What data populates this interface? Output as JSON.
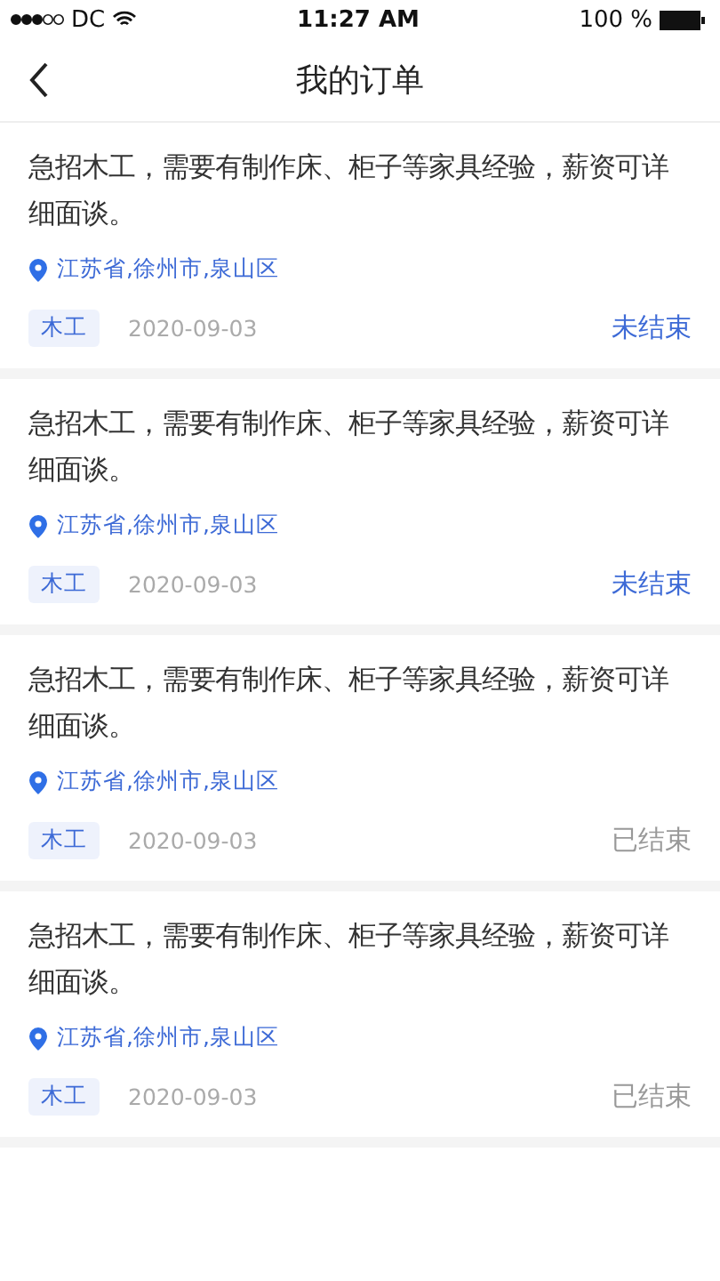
{
  "status_bar": {
    "carrier": "DC",
    "time": "11:27 AM",
    "battery": "100 %"
  },
  "header": {
    "title": "我的订单"
  },
  "orders": [
    {
      "description": "急招木工，需要有制作床、柜子等家具经验，薪资可详细面谈。",
      "location": "江苏省,徐州市,泉山区",
      "tag": "木工",
      "date": "2020-09-03",
      "status": "未结束",
      "finished": false
    },
    {
      "description": "急招木工，需要有制作床、柜子等家具经验，薪资可详细面谈。",
      "location": "江苏省,徐州市,泉山区",
      "tag": "木工",
      "date": "2020-09-03",
      "status": "未结束",
      "finished": false
    },
    {
      "description": "急招木工，需要有制作床、柜子等家具经验，薪资可详细面谈。",
      "location": "江苏省,徐州市,泉山区",
      "tag": "木工",
      "date": "2020-09-03",
      "status": "已结束",
      "finished": true
    },
    {
      "description": "急招木工，需要有制作床、柜子等家具经验，薪资可详细面谈。",
      "location": "江苏省,徐州市,泉山区",
      "tag": "木工",
      "date": "2020-09-03",
      "status": "已结束",
      "finished": true
    }
  ]
}
